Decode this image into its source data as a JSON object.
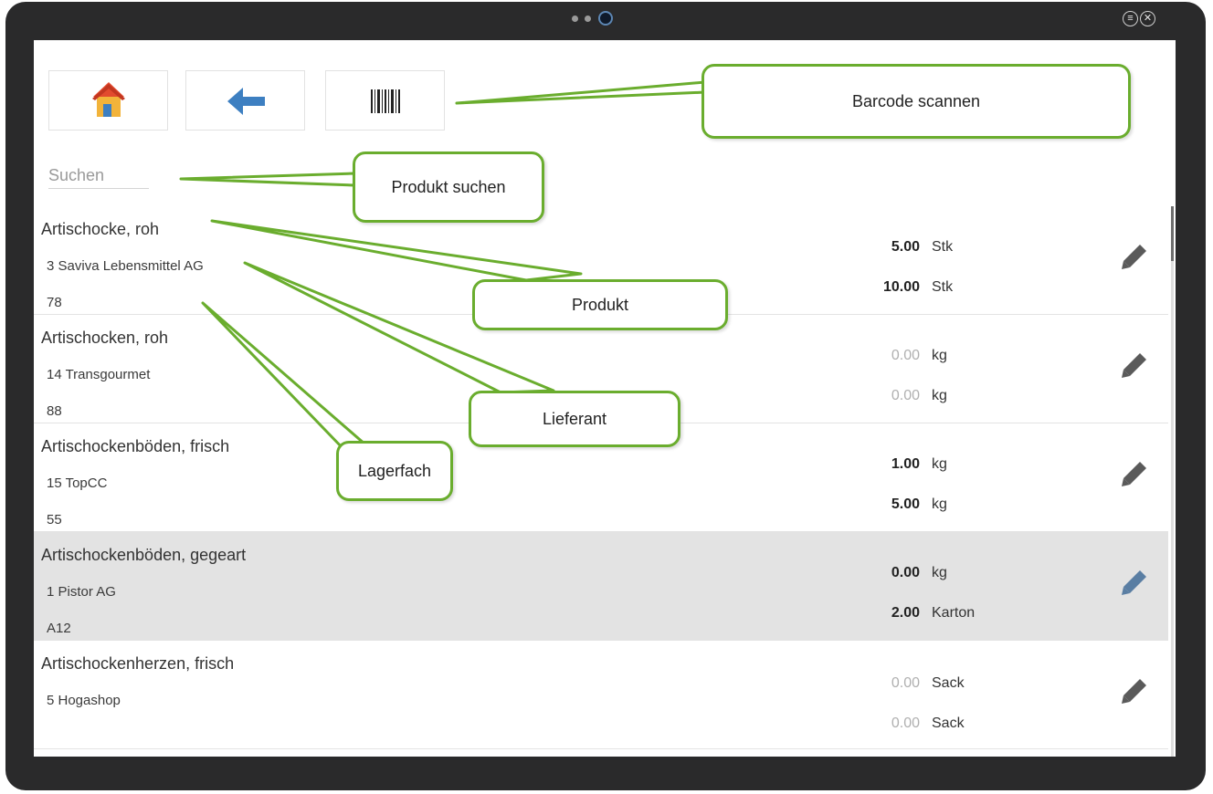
{
  "window": {
    "menu_icon": "menu-icon",
    "close_icon": "close-icon"
  },
  "toolbar": {
    "home_icon": "home-icon",
    "back_icon": "back-arrow-icon",
    "barcode_icon": "barcode-icon"
  },
  "search": {
    "placeholder": "Suchen"
  },
  "products": [
    {
      "name": "Artischocke, roh",
      "supplier": "3 Saviva Lebensmittel AG",
      "bin": "78",
      "qty1": "5.00",
      "unit1": "Stk",
      "qty2": "10.00",
      "unit2": "Stk",
      "selected": false
    },
    {
      "name": "Artischocken, roh",
      "supplier": "14 Transgourmet",
      "bin": "88",
      "qty1": "0.00",
      "unit1": "kg",
      "qty2": "0.00",
      "unit2": "kg",
      "selected": false
    },
    {
      "name": "Artischockenböden, frisch",
      "supplier": "15 TopCC",
      "bin": "55",
      "qty1": "1.00",
      "unit1": "kg",
      "qty2": "5.00",
      "unit2": "kg",
      "selected": false
    },
    {
      "name": "Artischockenböden, gegeart",
      "supplier": "1 Pistor AG",
      "bin": "A12",
      "qty1": "0.00",
      "unit1": "kg",
      "qty2": "2.00",
      "unit2": "Karton",
      "selected": true
    },
    {
      "name": "Artischockenherzen, frisch",
      "supplier": "5 Hogashop",
      "bin": "",
      "qty1": "0.00",
      "unit1": "Sack",
      "qty2": "0.00",
      "unit2": "Sack",
      "selected": false
    }
  ],
  "callouts": {
    "barcode": "Barcode scannen",
    "search": "Produkt suchen",
    "product": "Produkt",
    "supplier": "Lieferant",
    "bin": "Lagerfach"
  },
  "colors": {
    "callout_border": "#6aad2e",
    "selected_row": "#e3e3e3",
    "accent_blue": "#3d7fc1"
  }
}
